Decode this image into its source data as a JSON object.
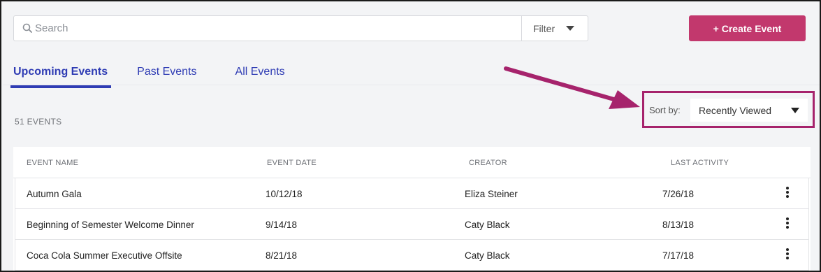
{
  "search": {
    "placeholder": "Search",
    "value": ""
  },
  "filter": {
    "label": "Filter"
  },
  "create_button": {
    "label": "+ Create Event"
  },
  "tabs": [
    {
      "label": "Upcoming Events",
      "active": true
    },
    {
      "label": "Past Events",
      "active": false
    },
    {
      "label": "All Events",
      "active": false
    }
  ],
  "event_count": "51 EVENTS",
  "sort": {
    "label": "Sort by:",
    "value": "Recently Viewed"
  },
  "table": {
    "columns": [
      "EVENT NAME",
      "EVENT DATE",
      "CREATOR",
      "LAST ACTIVITY"
    ],
    "rows": [
      {
        "name": "Autumn Gala",
        "date": "10/12/18",
        "creator": "Eliza Steiner",
        "last_activity": "7/26/18"
      },
      {
        "name": "Beginning of Semester Welcome Dinner",
        "date": "9/14/18",
        "creator": "Caty Black",
        "last_activity": "8/13/18"
      },
      {
        "name": "Coca Cola Summer Executive Offsite",
        "date": "8/21/18",
        "creator": "Caty Black",
        "last_activity": "7/17/18"
      }
    ]
  },
  "colors": {
    "accent_button": "#c2386d",
    "tab_active": "#2f3cb4",
    "callout": "#a6236c"
  },
  "icons": [
    "search-icon",
    "caret-down-icon",
    "kebab-menu-icon",
    "callout-arrow"
  ]
}
